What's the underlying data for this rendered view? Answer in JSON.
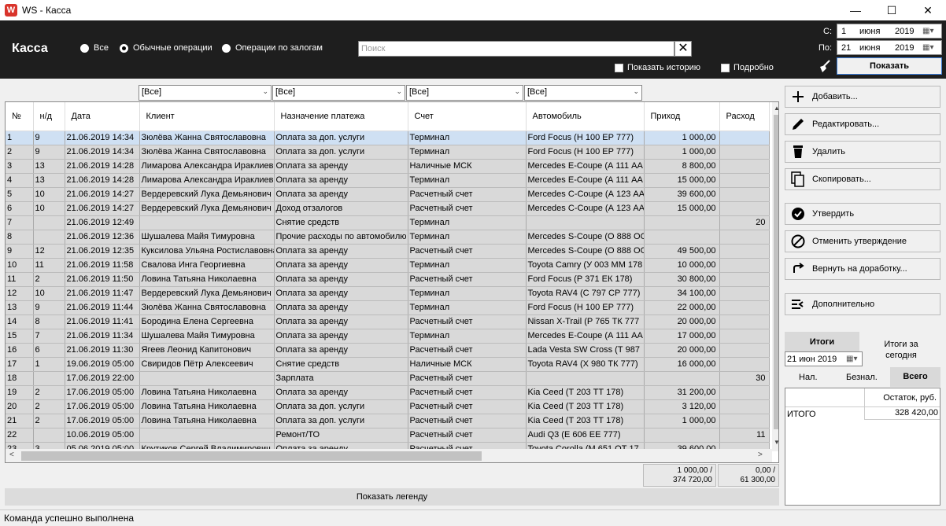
{
  "window": {
    "title": "WS - Касса",
    "app_icon": "W"
  },
  "header": {
    "title": "Касса",
    "radios": [
      {
        "label": "Все",
        "selected": false
      },
      {
        "label": "Обычные операции",
        "selected": true
      },
      {
        "label": "Операции по залогам",
        "selected": false
      }
    ],
    "search": {
      "placeholder": "Поиск",
      "value": ""
    },
    "show_history": "Показать историю",
    "details": "Подробно",
    "from_label": "С:",
    "to_label": "По:",
    "from_date": {
      "day": "1",
      "month": "июня",
      "year": "2019"
    },
    "to_date": {
      "day": "21",
      "month": "июня",
      "year": "2019"
    },
    "show_button": "Показать"
  },
  "filters": [
    "[Все]",
    "[Все]",
    "[Все]",
    "[Все]"
  ],
  "grid": {
    "columns": [
      "№",
      "н/д",
      "Дата",
      "Клиент",
      "Назначение платежа",
      "Счет",
      "Автомобиль",
      "Приход",
      "Расход"
    ],
    "rows": [
      [
        "1",
        "9",
        "21.06.2019 14:34",
        "Зюлёва Жанна Святославовна",
        "Оплата за доп. услуги",
        "Терминал",
        "Ford Focus (Н 100 ЕР 777)",
        "1 000,00",
        ""
      ],
      [
        "2",
        "9",
        "21.06.2019 14:34",
        "Зюлёва Жанна Святославовна",
        "Оплата за доп. услуги",
        "Терминал",
        "Ford Focus (Н 100 ЕР 777)",
        "1 000,00",
        ""
      ],
      [
        "3",
        "13",
        "21.06.2019 14:28",
        "Лимарова Александра Ираклиевна",
        "Оплата за аренду",
        "Наличные МСК",
        "Mercedes E-Coupe (А 111 АА",
        "8 800,00",
        ""
      ],
      [
        "4",
        "13",
        "21.06.2019 14:28",
        "Лимарова Александра Ираклиевна",
        "Оплата за аренду",
        "Терминал",
        "Mercedes E-Coupe (А 111 АА",
        "15 000,00",
        ""
      ],
      [
        "5",
        "10",
        "21.06.2019 14:27",
        "Вердеревский Лука Демьянович",
        "Оплата за аренду",
        "Расчетный счет",
        "Mercedes C-Coupe (А 123 АА",
        "39 600,00",
        ""
      ],
      [
        "6",
        "10",
        "21.06.2019 14:27",
        "Вердеревский Лука Демьянович",
        "Доход отзалогов",
        "Расчетный счет",
        "Mercedes C-Coupe (А 123 АА",
        "15 000,00",
        ""
      ],
      [
        "7",
        "",
        "21.06.2019 12:49",
        "",
        "Снятие средств",
        "Терминал",
        "",
        "",
        "20"
      ],
      [
        "8",
        "",
        "21.06.2019 12:36",
        "Шушалева Майя Тимуровна",
        "Прочие расходы по автомобилю",
        "Терминал",
        "Mercedes S-Coupe (О 888 ОО",
        "",
        ""
      ],
      [
        "9",
        "12",
        "21.06.2019 12:35",
        "Куксилова Ульяна Ростиславовна",
        "Оплата за аренду",
        "Расчетный счет",
        "Mercedes S-Coupe (О 888 ОО",
        "49 500,00",
        ""
      ],
      [
        "10",
        "11",
        "21.06.2019 11:58",
        "Свалова Инга Георгиевна",
        "Оплата за аренду",
        "Терминал",
        "Toyota Camry (У 003 ММ 178",
        "10 000,00",
        ""
      ],
      [
        "11",
        "2",
        "21.06.2019 11:50",
        "Ловина Татьяна Николаевна",
        "Оплата за аренду",
        "Расчетный счет",
        "Ford Focus (Р 371 ЕК 178)",
        "30 800,00",
        ""
      ],
      [
        "12",
        "10",
        "21.06.2019 11:47",
        "Вердеревский Лука Демьянович",
        "Оплата за аренду",
        "Терминал",
        "Toyota RAV4 (С 797 СР 777)",
        "34 100,00",
        ""
      ],
      [
        "13",
        "9",
        "21.06.2019 11:44",
        "Зюлёва Жанна Святославовна",
        "Оплата за аренду",
        "Терминал",
        "Ford Focus (Н 100 ЕР 777)",
        "22 000,00",
        ""
      ],
      [
        "14",
        "8",
        "21.06.2019 11:41",
        "Бородина Елена Сергеевна",
        "Оплата за аренду",
        "Расчетный счет",
        "Nissan X-Trail (Р 765 ТК 777",
        "20 000,00",
        ""
      ],
      [
        "15",
        "7",
        "21.06.2019 11:34",
        "Шушалева Майя Тимуровна",
        "Оплата за аренду",
        "Терминал",
        "Mercedes E-Coupe (А 111 АА",
        "17 000,00",
        ""
      ],
      [
        "16",
        "6",
        "21.06.2019 11:30",
        "Ягеев Леонид Капитонович",
        "Оплата за аренду",
        "Расчетный счет",
        "Lada Vesta SW Cross (Т 987",
        "20 000,00",
        ""
      ],
      [
        "17",
        "1",
        "19.06.2019 05:00",
        "Свиридов Пётр Алексеевич",
        "Снятие средств",
        "Наличные МСК",
        "Toyota RAV4 (Х 980 ТК 777)",
        "16 000,00",
        ""
      ],
      [
        "18",
        "",
        "17.06.2019 22:00",
        "",
        "Зарплата",
        "Расчетный счет",
        "",
        "",
        "30"
      ],
      [
        "19",
        "2",
        "17.06.2019 05:00",
        "Ловина Татьяна Николаевна",
        "Оплата за аренду",
        "Расчетный счет",
        "Kia Ceed (Т 203 ТТ 178)",
        "31 200,00",
        ""
      ],
      [
        "20",
        "2",
        "17.06.2019 05:00",
        "Ловина Татьяна Николаевна",
        "Оплата за доп. услуги",
        "Расчетный счет",
        "Kia Ceed (Т 203 ТТ 178)",
        "3 120,00",
        ""
      ],
      [
        "21",
        "2",
        "17.06.2019 05:00",
        "Ловина Татьяна Николаевна",
        "Оплата за доп. услуги",
        "Расчетный счет",
        "Kia Ceed (Т 203 ТТ 178)",
        "1 000,00",
        ""
      ],
      [
        "22",
        "",
        "10.06.2019 05:00",
        "",
        "Ремонт/ТО",
        "Расчетный счет",
        "Audi Q3 (Е 606 ЕЕ 777)",
        "",
        "11"
      ],
      [
        "23",
        "3",
        "05.06.2019 05:00",
        "Крутиков Сергей Владимирович",
        "Оплата за аренду",
        "Расчетный счет",
        "Toyota Corolla (М 651 ОТ 17",
        "39 600,00",
        ""
      ]
    ]
  },
  "totals": {
    "income_line1": "1 000,00 /",
    "income_line2": "374 720,00",
    "expense_line1": "0,00 /",
    "expense_line2": "61 300,00"
  },
  "legend_button": "Показать легенду",
  "actions": [
    {
      "label": "Добавить...",
      "icon": "plus-icon"
    },
    {
      "label": "Редактировать...",
      "icon": "pencil-icon"
    },
    {
      "label": "Удалить",
      "icon": "trash-icon"
    },
    {
      "label": "Скопировать...",
      "icon": "copy-icon"
    },
    {
      "label": "Утвердить",
      "icon": "check-circle-icon"
    },
    {
      "label": "Отменить утверждение",
      "icon": "cancel-circle-icon"
    },
    {
      "label": "Вернуть на доработку...",
      "icon": "return-arrow-icon"
    },
    {
      "label": "Дополнительно",
      "icon": "more-list-icon"
    }
  ],
  "summary": {
    "itogi_button": "Итоги",
    "today_label": "Итоги за сегодня",
    "date": "21 июн 2019",
    "tabs": [
      "Нал.",
      "Безнал.",
      "Всего"
    ],
    "active_tab": "Всего",
    "col_header": "Остаток, руб.",
    "row_label": "ИТОГО",
    "row_value": "328 420,00"
  },
  "status": "Команда успешно выполнена",
  "colors": {
    "header_bg": "#1e1e1e",
    "row_bg": "#d9d9d9",
    "selected_row": "#cfe0f3",
    "accent": "#3a7bd5"
  }
}
